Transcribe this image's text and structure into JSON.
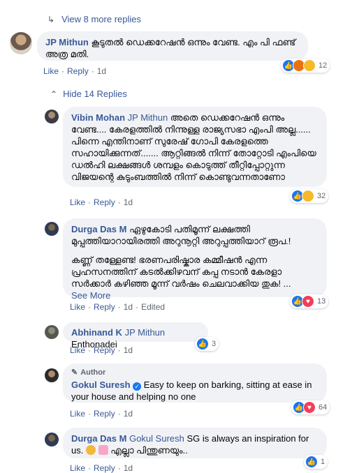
{
  "view_more": {
    "label": "View 8 more replies"
  },
  "hide_replies": {
    "label": "Hide 14 Replies"
  },
  "comments": [
    {
      "name": "JP Mithun",
      "text": "കൂടുതൽ ഡെക്കറേഷൻ ഒന്നും വേണ്ട. എം പി ഫണ്ട് അത്ര മതി.",
      "like": "Like",
      "reply": "Reply",
      "time": "1d",
      "reactions": "12"
    },
    {
      "name": "Vibin Mohan",
      "mention": "JP Mithun",
      "text": "അതെ ഡെക്കറേഷൻ ഒന്നും വേണ്ട.... കേരളത്തിൽ നിന്നുള്ള രാജ്യസഭാ എംപി അല്ല...... പിന്നെ എന്തിനാണ് സുരേഷ് ഗോപി കേരളത്തെ സഹായിക്കുന്നത്....... ആറ്റിങ്ങൽ നിന്ന് തോറ്റോടി എംപിയെ ഡൽഹി ലക്ഷങ്ങൾ ശമ്പളം കൊടുത്ത് തീറ്റിപ്പോറ്റുന്ന വിജയന്റെ കുടുംബത്തിൽ നിന്ന് കൊണ്ടുവന്നതാണോ",
      "like": "Like",
      "reply": "Reply",
      "time": "1d",
      "reactions": "32"
    },
    {
      "name": "Durga Das M",
      "text": "ഏഴുകോടി പതിമൂന്ന് ലക്ഷത്തി മുപ്പത്തിയാറായിരത്തി അറുനൂറ്റി അറുപ്പത്തിയാറ് രൂപ.!",
      "text2": "കണ്ണ് തള്ളേണ്ട! ഭരണപരിഷ്കാര കമ്മീഷൻ എന്ന പ്രഹസനത്തിന് കടൽക്കിഴവന് കപ്പ നടാൻ കേരളാ സർക്കാർ കഴിഞ്ഞ മൂന്ന് വർഷം ചെലവാക്കിയ തുക! ...",
      "see_more": "See More",
      "like": "Like",
      "reply": "Reply",
      "time": "1d",
      "edited": "Edited",
      "reactions": "13"
    },
    {
      "name": "Abhinand K",
      "mention": "JP Mithun",
      "text": "Enthonadei",
      "like": "Like",
      "reply": "Reply",
      "time": "1d",
      "reactions": "3"
    },
    {
      "author_badge": "Author",
      "name": "Gokul Suresh",
      "text": "Easy to keep on barking, sitting at ease in your house and helping no one",
      "like": "Like",
      "reply": "Reply",
      "time": "1d",
      "reactions": "64"
    },
    {
      "name": "Durga Das M",
      "mention": "Gokul Suresh",
      "text": "SG is always an inspiration for us.",
      "text_after": "എല്ലാ പിന്തുണയും..",
      "like": "Like",
      "reply": "Reply",
      "time": "1d",
      "reactions": "1"
    }
  ]
}
